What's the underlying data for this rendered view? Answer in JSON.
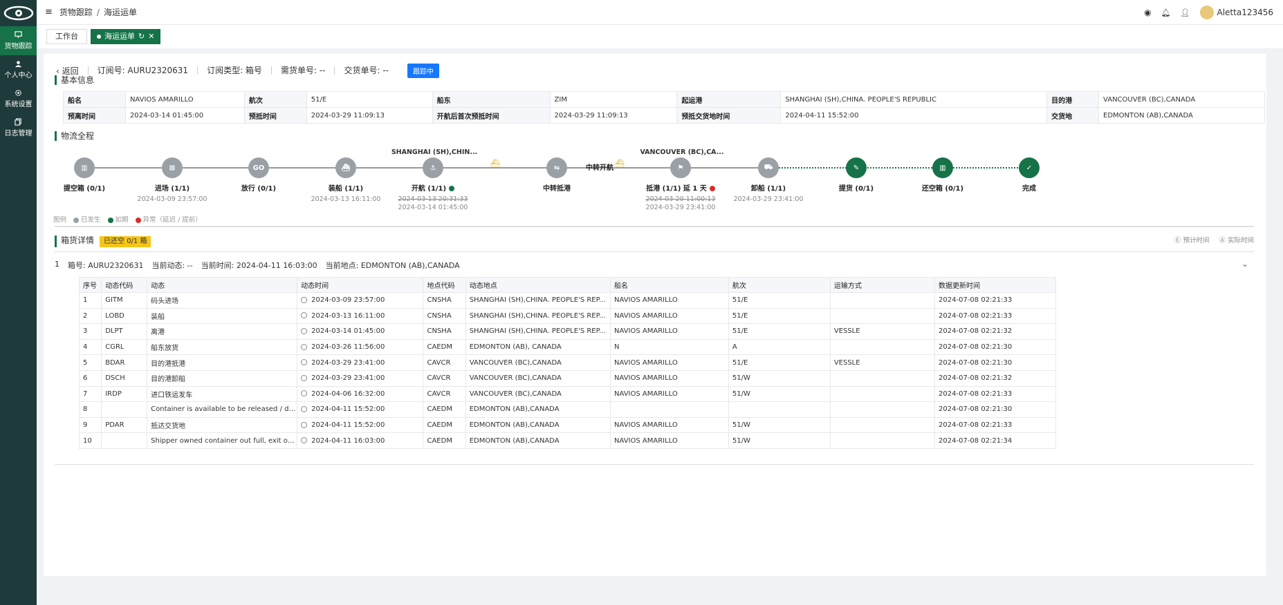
{
  "sidebar": {
    "items": [
      {
        "label": "货物跟踪",
        "icon": "monitor-icon"
      },
      {
        "label": "个人中心",
        "icon": "user-icon"
      },
      {
        "label": "系统设置",
        "icon": "gear-icon"
      },
      {
        "label": "日志管理",
        "icon": "copy-icon"
      }
    ]
  },
  "header": {
    "breadcrumb": [
      "货物跟踪",
      "海运运单"
    ],
    "username": "Aletta123456"
  },
  "tabs": [
    {
      "label": "工作台"
    },
    {
      "label": "海运运单"
    }
  ],
  "order": {
    "back_label": "返回",
    "booking_no": "订阅号: AURU2320631",
    "sub_type": "订阅类型: 箱号",
    "bill_no": "需货单号: --",
    "delivery_no": "交货单号: --",
    "status": "跟踪中"
  },
  "basic_info": {
    "title": "基本信息",
    "rows": [
      [
        "船名",
        "NAVIOS AMARILLO",
        "航次",
        "51/E",
        "船东",
        "ZIM",
        "起运港",
        "SHANGHAI (SH),CHINA. PEOPLE'S REPUBLIC",
        "目的港",
        "VANCOUVER (BC),CANADA"
      ],
      [
        "预离时间",
        "2024-03-14 01:45:00",
        "预抵时间",
        "2024-03-29 11:09:13",
        "开航后首次预抵时间",
        "2024-03-29 11:09:13",
        "预抵交货地时间",
        "2024-04-11 15:52:00",
        "交货地",
        "EDMONTON (AB),CANADA"
      ]
    ]
  },
  "logistics": {
    "title": "物流全程",
    "origin_port": "SHANGHAI (SH),CHIN...",
    "dest_port": "VANCOUVER (BC),CA...",
    "nodes": [
      {
        "label": "提空箱 (0/1)",
        "sub1": "",
        "sub2": "",
        "glyph": "▥"
      },
      {
        "label": "进场 (1/1)",
        "sub1": "2024-03-09 23:57:00",
        "sub2": "",
        "glyph": "⊠"
      },
      {
        "label": "放行 (0/1)",
        "sub1": "",
        "sub2": "",
        "glyph": "GO"
      },
      {
        "label": "装船 (1/1)",
        "sub1": "2024-03-13 16:11:00",
        "sub2": "",
        "glyph": "⛴"
      },
      {
        "label": "开航 (1/1)",
        "sub1": "2024-03-13 20:31:33",
        "sub2": "2024-03-14 01:45:00",
        "glyph": "⚓"
      },
      {
        "label": "中转抵港",
        "sub1": "",
        "sub2": "",
        "glyph": "⇋"
      },
      {
        "label": "中转开航",
        "sub1": "",
        "sub2": "",
        "glyph": ""
      },
      {
        "label": "抵港 (1/1)  延 1 天",
        "sub1": "2024-03-20 11:00:13",
        "sub2": "2024-03-29 23:41:00",
        "glyph": "⚑"
      },
      {
        "label": "卸船 (1/1)",
        "sub1": "2024-03-29 23:41:00",
        "sub2": "",
        "glyph": "⛟"
      },
      {
        "label": "提货 (0/1)",
        "sub1": "",
        "sub2": "",
        "glyph": "✎"
      },
      {
        "label": "还空箱 (0/1)",
        "sub1": "",
        "sub2": "",
        "glyph": "▥"
      },
      {
        "label": "完成",
        "sub1": "",
        "sub2": "",
        "glyph": "✓"
      }
    ],
    "legend": {
      "title": "图例",
      "occurred": "已发生",
      "ontime": "如期",
      "abnormal": "异常（延迟 / 提前）"
    }
  },
  "containers": {
    "title": "箱货详情",
    "badge": "已还空 0/1 箱",
    "estimated": "预计时间",
    "actual": "实际时间",
    "row": {
      "index": "1",
      "no": "箱号: AURU2320631",
      "status": "当前动态: --",
      "time": "当前时间: 2024-04-11 16:03:00",
      "place": "当前地点: EDMONTON (AB),CANADA"
    },
    "columns": [
      "序号",
      "动态代码",
      "动态",
      "动态时间",
      "地点代码",
      "动态地点",
      "船名",
      "航次",
      "运输方式",
      "数据更新时间"
    ],
    "rows": [
      [
        "1",
        "GITM",
        "码头进场",
        "2024-03-09 23:57:00",
        "CNSHA",
        "SHANGHAI (SH),CHINA. PEOPLE'S REP...",
        "NAVIOS AMARILLO",
        "51/E",
        "",
        "2024-07-08 02:21:33"
      ],
      [
        "2",
        "LOBD",
        "装船",
        "2024-03-13 16:11:00",
        "CNSHA",
        "SHANGHAI (SH),CHINA. PEOPLE'S REP...",
        "NAVIOS AMARILLO",
        "51/E",
        "",
        "2024-07-08 02:21:33"
      ],
      [
        "3",
        "DLPT",
        "离港",
        "2024-03-14 01:45:00",
        "CNSHA",
        "SHANGHAI (SH),CHINA. PEOPLE'S REP...",
        "NAVIOS AMARILLO",
        "51/E",
        "VESSLE",
        "2024-07-08 02:21:32"
      ],
      [
        "4",
        "CGRL",
        "船东放货",
        "2024-03-26 11:56:00",
        "CAEDM",
        "EDMONTON (AB), CANADA",
        "N",
        "A",
        "",
        "2024-07-08 02:21:30"
      ],
      [
        "5",
        "BDAR",
        "目的港抵港",
        "2024-03-29 23:41:00",
        "CAVCR",
        "VANCOUVER (BC),CANADA",
        "NAVIOS AMARILLO",
        "51/E",
        "VESSLE",
        "2024-07-08 02:21:30"
      ],
      [
        "6",
        "DSCH",
        "目的港卸船",
        "2024-03-29 23:41:00",
        "CAVCR",
        "VANCOUVER (BC),CANADA",
        "NAVIOS AMARILLO",
        "51/W",
        "",
        "2024-07-08 02:21:32"
      ],
      [
        "7",
        "IRDP",
        "进口铁运发车",
        "2024-04-06 16:32:00",
        "CAVCR",
        "VANCOUVER (BC),CANADA",
        "NAVIOS AMARILLO",
        "51/W",
        "",
        "2024-07-08 02:21:33"
      ],
      [
        "8",
        "",
        "Container is available to be released / deliv...",
        "2024-04-11 15:52:00",
        "CAEDM",
        "EDMONTON (AB),CANADA",
        "",
        "",
        "",
        "2024-07-08 02:21:30"
      ],
      [
        "9",
        "PDAR",
        "抵达交货地",
        "2024-04-11 15:52:00",
        "CAEDM",
        "EDMONTON (AB),CANADA",
        "NAVIOS AMARILLO",
        "51/W",
        "",
        "2024-07-08 02:21:33"
      ],
      [
        "10",
        "",
        "Shipper owned container out full, exit of a f...",
        "2024-04-11 16:03:00",
        "CAEDM",
        "EDMONTON (AB),CANADA",
        "NAVIOS AMARILLO",
        "51/W",
        "",
        "2024-07-08 02:21:34"
      ]
    ]
  }
}
